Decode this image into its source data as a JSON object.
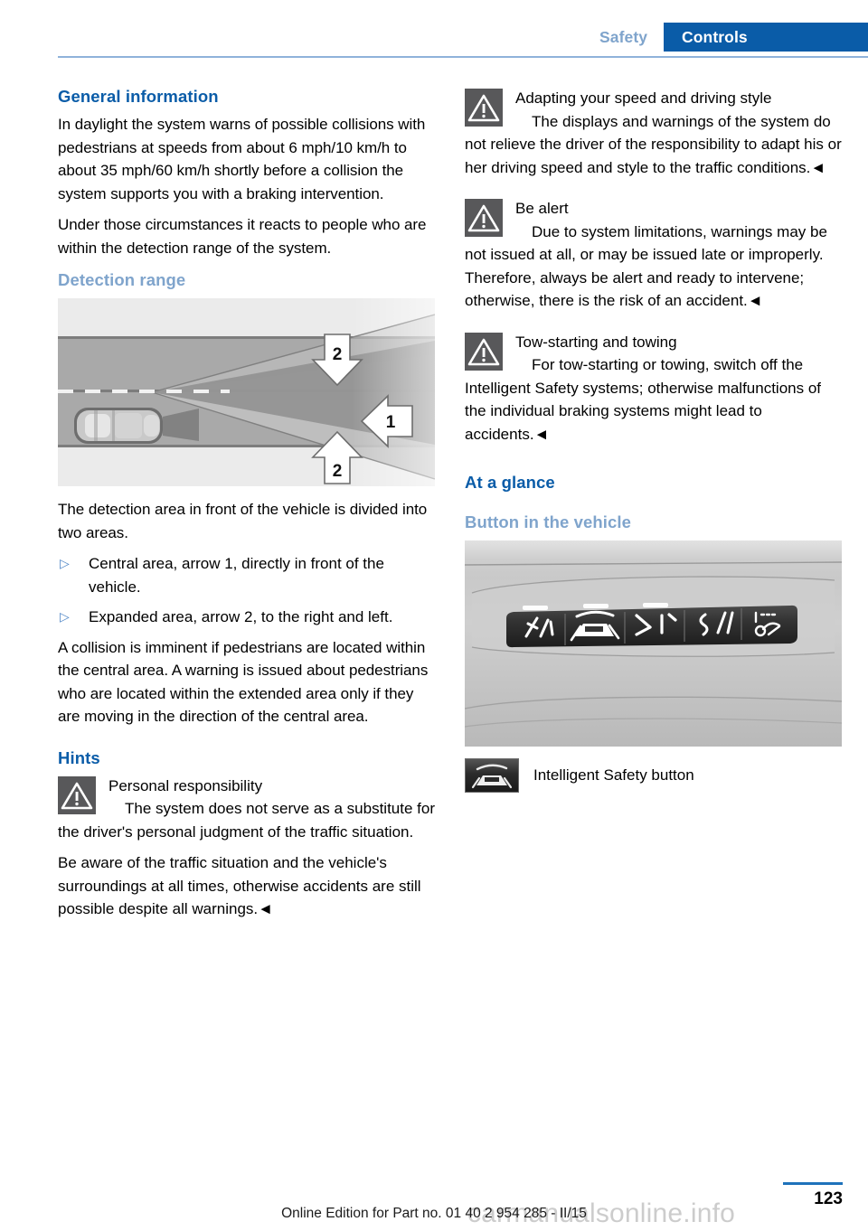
{
  "header": {
    "tab_inactive": "Safety",
    "tab_active": "Controls",
    "accent_blue": "#0a5ca8",
    "light_blue": "#7fa4cc",
    "rule_color": "#8fb2da"
  },
  "left": {
    "h_general": "General information",
    "p1": "In daylight the system warns of possible colli­sions with pedestrians at speeds from about 6 mph/10 km/h to about 35 mph/60 km/h shortly before a collision the system supports you with a braking intervention.",
    "p2": "Under those circumstances it reacts to people who are within the detection range of the sys­tem.",
    "h_detection": "Detection range",
    "illustration": {
      "name": "detection-range-diagram",
      "arrow_central": "1",
      "arrow_expanded_top": "2",
      "arrow_expanded_bottom": "2"
    },
    "p3": "The detection area in front of the vehicle is div­ided into two areas.",
    "bullets": [
      {
        "mark": "▷",
        "text": "Central area, arrow 1, directly in front of the vehicle."
      },
      {
        "mark": "▷",
        "text": "Expanded area, arrow 2, to the right and left."
      }
    ],
    "p4": "A collision is imminent if pedestrians are lo­cated within the central area. A warning is is­sued about pedestrians who are located within the extended area only if they are moving in the direction of the central area.",
    "h_hints": "Hints",
    "warning": {
      "title": "Personal responsibility",
      "body": "The system does not serve as a substi­tute for the driver's personal judgment of the traffic situation.",
      "body2": "Be aware of the traffic situation and the vehi­cle's surroundings at all times, otherwise acci­dents are still possible despite all warnings.◄"
    }
  },
  "right": {
    "warnings": [
      {
        "title": "Adapting your speed and driving style",
        "body": "The displays and warnings of the system do not relieve the driver of the responsibility to adapt his or her driving speed and style to the traffic conditions.◄"
      },
      {
        "title": "Be alert",
        "body": "Due to system limitations, warnings may be not issued at all, or may be issued late or improperly. Therefore, always be alert and ready to intervene; otherwise, there is the risk of an accident.◄"
      },
      {
        "title": "Tow-starting and towing",
        "body": "For tow-starting or towing, switch off the Intelligent Safety systems; otherwise malfunc­tions of the individual braking systems might lead to accidents.◄"
      }
    ],
    "h_glance": "At a glance",
    "h_button": "Button in the vehicle",
    "photo": {
      "name": "intelligent-safety-button-panel-photo",
      "buttons": [
        "lane-departure-warning-button",
        "intelligent-safety-button",
        "head-up-display-button",
        "lane-change-warning-button",
        "parking-assistant-button"
      ]
    },
    "caption": "Intelligent Safety button"
  },
  "footer": {
    "page_number": "123",
    "edition_text": "Online Edition for Part no. 01 40 2 954 285 - II/15",
    "watermark": "carmanualsonline.info",
    "rule_color": "#1e72bb"
  }
}
